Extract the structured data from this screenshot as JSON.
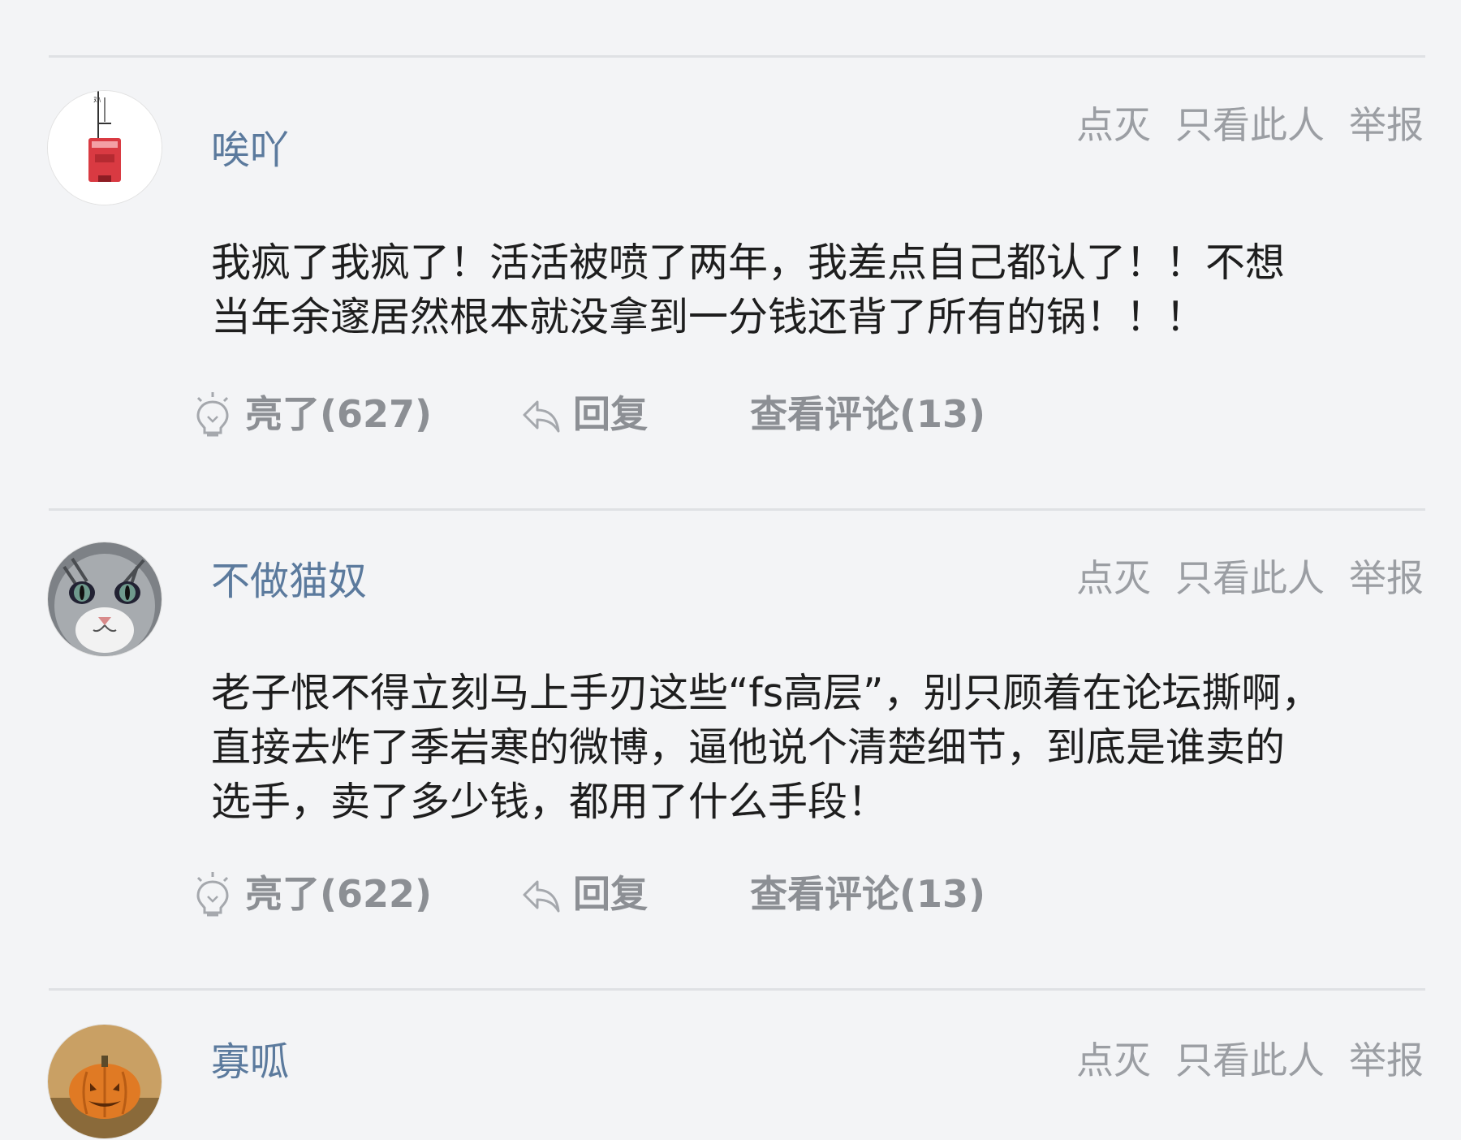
{
  "posts": [
    {
      "username": "唉吖",
      "avatar_icon": "tram-sign-avatar",
      "top_actions": {
        "dislike": "点灭",
        "only_this": "只看此人",
        "report": "举报"
      },
      "content": "我疯了我疯了！活活被喷了两年，我差点自己都认了！！不想\n当年余邃居然根本就没拿到一分钱还背了所有的锅！！！",
      "footer": {
        "like": "亮了(627)",
        "reply": "回复",
        "comments": "查看评论(13)"
      }
    },
    {
      "username": "不做猫奴",
      "avatar_icon": "cat-avatar",
      "top_actions": {
        "dislike": "点灭",
        "only_this": "只看此人",
        "report": "举报"
      },
      "content": "老子恨不得立刻马上手刃这些“fs高层”，别只顾着在论坛撕啊，\n直接去炸了季岩寒的微博，逼他说个清楚细节，到底是谁卖的\n选手，卖了多少钱，都用了什么手段！",
      "footer": {
        "like": "亮了(622)",
        "reply": "回复",
        "comments": "查看评论(13)"
      }
    },
    {
      "username": "寡呱",
      "avatar_icon": "pumpkin-avatar",
      "top_actions": {
        "dislike": "点灭",
        "only_this": "只看此人",
        "report": "举报"
      }
    }
  ],
  "icons": {
    "like": "lightbulb-icon",
    "reply": "reply-arrow-icon"
  },
  "colors": {
    "username": "#5b7a9d",
    "action": "#9b9ea3",
    "background": "#f3f4f6"
  }
}
